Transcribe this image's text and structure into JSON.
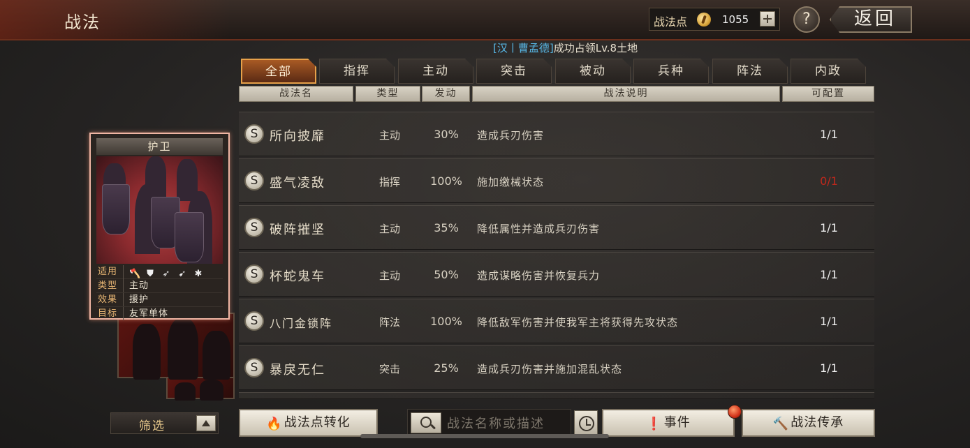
{
  "header": {
    "title": "战法",
    "points_label": "战法点",
    "points_value": "1055",
    "help_label": "?",
    "back_label": "返回"
  },
  "notice": {
    "faction": "[汉丨曹孟德]",
    "text": "成功占领Lv.8土地"
  },
  "tabs": [
    {
      "label": "全部",
      "active": true
    },
    {
      "label": "指挥"
    },
    {
      "label": "主动"
    },
    {
      "label": "突击"
    },
    {
      "label": "被动"
    },
    {
      "label": "兵种"
    },
    {
      "label": "阵法"
    },
    {
      "label": "内政"
    }
  ],
  "columns": {
    "name": "战法名",
    "type": "类型",
    "rate": "发动",
    "desc": "战法说明",
    "config": "可配置"
  },
  "tactics": [
    {
      "badge": "S",
      "name": "所向披靡",
      "type": "主动",
      "rate": "30%",
      "desc": "造成兵刃伤害",
      "config": "1/1",
      "unavailable": false
    },
    {
      "badge": "S",
      "name": "盛气凌敌",
      "type": "指挥",
      "rate": "100%",
      "desc": "施加缴械状态",
      "config": "0/1",
      "unavailable": true
    },
    {
      "badge": "S",
      "name": "破阵摧坚",
      "type": "主动",
      "rate": "35%",
      "desc": "降低属性并造成兵刃伤害",
      "config": "1/1",
      "unavailable": false
    },
    {
      "badge": "S",
      "name": "杯蛇鬼车",
      "type": "主动",
      "rate": "50%",
      "desc": "造成谋略伤害并恢复兵力",
      "config": "1/1",
      "unavailable": false
    },
    {
      "badge": "S",
      "name": "八门金锁阵",
      "type": "阵法",
      "rate": "100%",
      "desc": "降低敌军伤害并使我军主将获得先攻状态",
      "config": "1/1",
      "unavailable": false
    },
    {
      "badge": "S",
      "name": "暴戾无仁",
      "type": "突击",
      "rate": "25%",
      "desc": "造成兵刃伤害并施加混乱状态",
      "config": "1/1",
      "unavailable": false
    }
  ],
  "card": {
    "title": "护卫",
    "applies_label": "适用",
    "applies_icons": [
      "axe-icon",
      "shield-icon",
      "bow-icon",
      "spear-icon",
      "wheel-icon"
    ],
    "type_label": "类型",
    "type_value": "主动",
    "effect_label": "效果",
    "effect_value": "援护",
    "target_label": "目标",
    "target_value": "友军单体"
  },
  "bottom": {
    "filter_label": "筛选",
    "convert_label": "战法点转化",
    "search_placeholder": "战法名称或描述",
    "event_label": "事件",
    "inherit_label": "战法传承"
  },
  "colors": {
    "accent_orange": "#e7a14a",
    "unavailable_red": "#c0281c",
    "faction_blue": "#58b9e8"
  }
}
